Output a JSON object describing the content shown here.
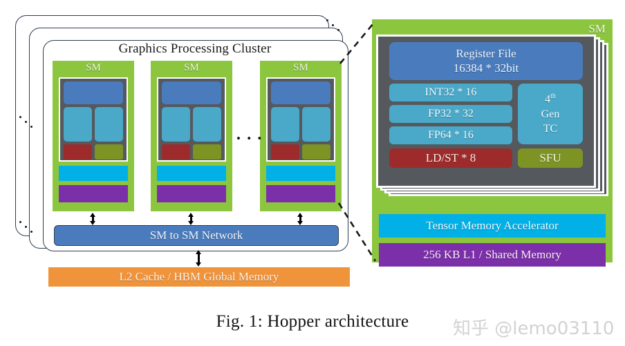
{
  "figure": {
    "caption": "Fig. 1: Hopper architecture",
    "watermark": "知乎 @lemo03110"
  },
  "cluster": {
    "title": "Graphics Processing Cluster",
    "ellipsis_horizontal": "• • •",
    "sm_label": "SM",
    "sms": [
      {
        "label": "SM"
      },
      {
        "label": "SM"
      },
      {
        "label": "SM"
      }
    ],
    "network_label": "SM to SM Network",
    "memory_label": "L2 Cache / HBM Global Memory"
  },
  "sm_detail": {
    "panel_label": "SM",
    "register_file": {
      "name": "Register File",
      "size": "16384 * 32bit"
    },
    "units": [
      {
        "label": "INT32 * 16"
      },
      {
        "label": "FP32   * 32"
      },
      {
        "label": "FP64   * 16"
      }
    ],
    "tensor_core": {
      "gen": "4",
      "gen_suffix": "th",
      "line2": "Gen",
      "line3": "TC"
    },
    "ldst_label": "LD/ST * 8",
    "sfu_label": "SFU",
    "tma_label": "Tensor Memory Accelerator",
    "l1_label": "256 KB L1 / Shared Memory"
  },
  "colors": {
    "green": "#8cc63f",
    "blue": "#4a7cbd",
    "cyan_unit": "#4aa8c8",
    "cyan_bar": "#00b0e6",
    "purple": "#7b2fa8",
    "red": "#9e2b2b",
    "olive": "#7d9425",
    "orange": "#f0943c",
    "card_gray": "#55585c",
    "outline": "#2e3b4e"
  }
}
